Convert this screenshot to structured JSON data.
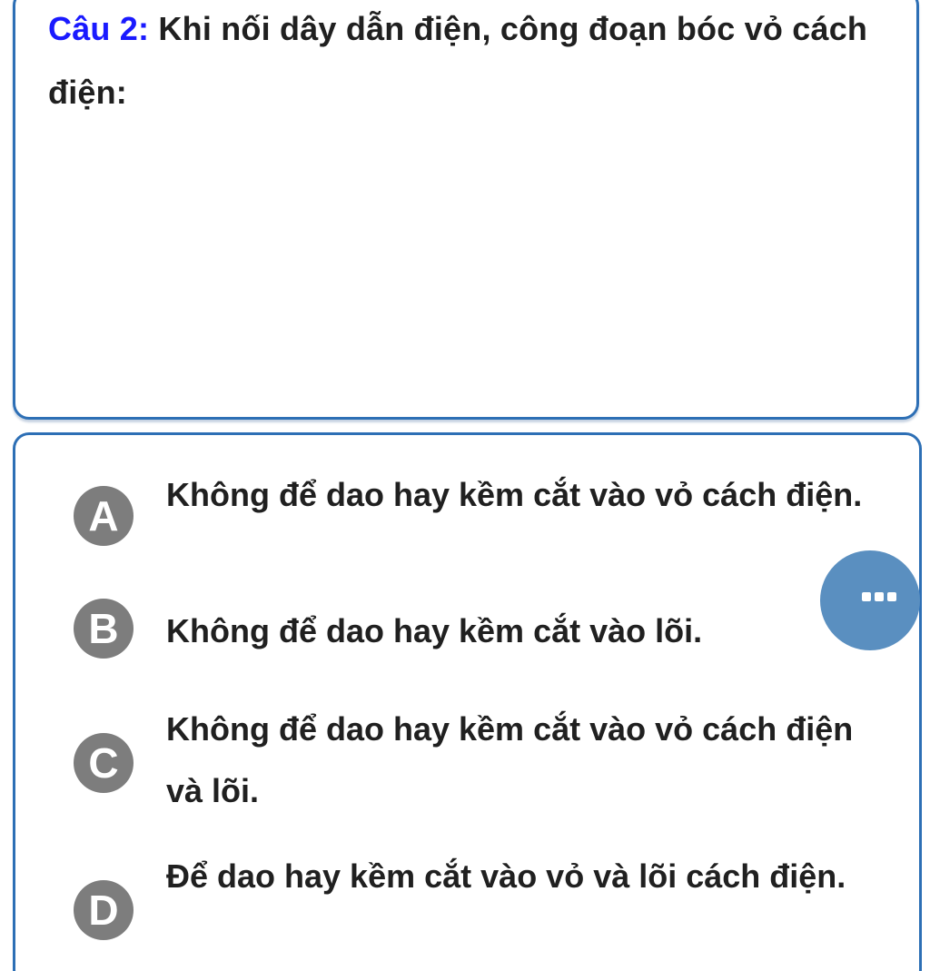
{
  "question": {
    "number_label": "Câu 2:",
    "text": " Khi nối dây dẫn điện, công đoạn bóc vỏ cách điện:"
  },
  "options": [
    {
      "letter": "A",
      "text": "Không để dao hay kềm cắt vào vỏ cách điện."
    },
    {
      "letter": "B",
      "text": "Không để dao hay kềm cắt vào lõi."
    },
    {
      "letter": "C",
      "text": "Không để dao hay kềm cắt vào vỏ cách điện và lõi."
    },
    {
      "letter": "D",
      "text": "Để dao hay kềm cắt vào vỏ và lõi cách điện."
    }
  ],
  "more_button": {
    "icon": "more-horizontal-icon"
  },
  "colors": {
    "accent_border": "#2d6fb5",
    "question_number": "#1a1aff",
    "badge": "#7d7d7d",
    "floating_button": "#5a8fc0"
  }
}
